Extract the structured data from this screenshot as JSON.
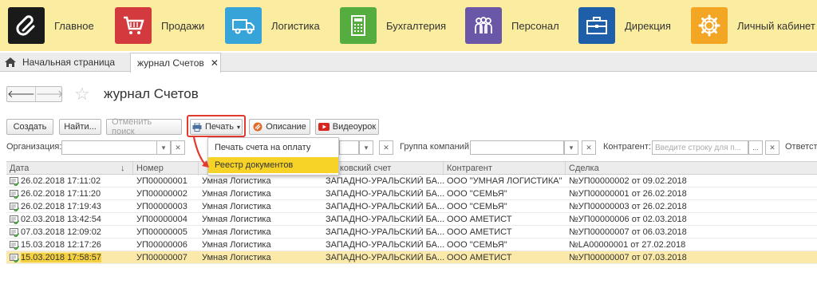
{
  "sections": [
    {
      "label": "Главное",
      "color": "#1a1a1a",
      "icon": "paperclip-icon"
    },
    {
      "label": "Продажи",
      "color": "#d23a3e",
      "icon": "cart-icon"
    },
    {
      "label": "Логистика",
      "color": "#36a3d9",
      "icon": "truck-icon"
    },
    {
      "label": "Бухгалтерия",
      "color": "#56ad3f",
      "icon": "calculator-icon"
    },
    {
      "label": "Персонал",
      "color": "#6b57a8",
      "icon": "people-icon"
    },
    {
      "label": "Дирекция",
      "color": "#1f5ea8",
      "icon": "briefcase-icon"
    },
    {
      "label": "Личный кабинет",
      "color": "#f2a624",
      "icon": "gear-icon"
    }
  ],
  "tabs": {
    "home_label": "Начальная страница",
    "active_label": "журнал Счетов",
    "close_glyph": "✕"
  },
  "header": {
    "back_glyph": "🡐",
    "forward_glyph": "🡒",
    "star_glyph": "☆",
    "title": "журнал Счетов"
  },
  "toolbar": {
    "create": "Создать",
    "find": "Найти...",
    "cancel_search": "Отменить поиск",
    "print": "Печать",
    "description": "Описание",
    "video": "Видеоурок"
  },
  "filters": {
    "org_label": "Организация:",
    "group_label": "Группа компаний:",
    "contractor_label": "Контрагент:",
    "contractor_placeholder": "Введите строку для п...",
    "responsible_label": "Ответств",
    "dropdown_glyph": "▾",
    "clear_glyph": "✕",
    "more_glyph": "..."
  },
  "print_menu": {
    "items": [
      "Печать счета на оплату",
      "Реестр документов"
    ],
    "highlighted_index": 1
  },
  "table": {
    "columns": [
      "Дата",
      "Номер",
      "",
      "ковский счет",
      "Контрагент",
      "Сделка"
    ],
    "sort_glyph": "↓",
    "rows": [
      {
        "date": "26.02.2018 17:11:02",
        "number": "УП00000001",
        "org": "Умная Логистика",
        "bank": "ЗАПАДНО-УРАЛЬСКИЙ БА...",
        "contractor": "ООО \"УМНАЯ ЛОГИСТИКА\"",
        "deal": "№УП00000002 от 09.02.2018"
      },
      {
        "date": "26.02.2018 17:11:20",
        "number": "УП00000002",
        "org": "Умная Логистика",
        "bank": "ЗАПАДНО-УРАЛЬСКИЙ БА...",
        "contractor": "ООО \"СЕМЬЯ\"",
        "deal": "№УП00000001 от 26.02.2018"
      },
      {
        "date": "26.02.2018 17:19:43",
        "number": "УП00000003",
        "org": "Умная Логистика",
        "bank": "ЗАПАДНО-УРАЛЬСКИЙ БА...",
        "contractor": "ООО \"СЕМЬЯ\"",
        "deal": "№УП00000003 от 26.02.2018"
      },
      {
        "date": "02.03.2018 13:42:54",
        "number": "УП00000004",
        "org": "Умная Логистика",
        "bank": "ЗАПАДНО-УРАЛЬСКИЙ БА...",
        "contractor": "ООО АМЕТИСТ",
        "deal": "№УП00000006 от 02.03.2018"
      },
      {
        "date": "07.03.2018 12:09:02",
        "number": "УП00000005",
        "org": "Умная Логистика",
        "bank": "ЗАПАДНО-УРАЛЬСКИЙ БА...",
        "contractor": "ООО АМЕТИСТ",
        "deal": "№УП00000007 от 06.03.2018"
      },
      {
        "date": "15.03.2018 12:17:26",
        "number": "УП00000006",
        "org": "Умная Логистика",
        "bank": "ЗАПАДНО-УРАЛЬСКИЙ БА...",
        "contractor": "ООО \"СЕМЬЯ\"",
        "deal": "№LA00000001 от 27.02.2018"
      },
      {
        "date": "15.03.2018 17:58:57",
        "number": "УП00000007",
        "org": "Умная Логистика",
        "bank": "ЗАПАДНО-УРАЛЬСКИЙ БА...",
        "contractor": "ООО АМЕТИСТ",
        "deal": "№УП00000007 от 07.03.2018"
      }
    ],
    "selected_row_index": 6
  },
  "colors": {
    "topbar": "#fbeda0",
    "highlight_box": "#e23a2f",
    "menu_highlight": "#f7d327",
    "selected_row": "#fae9a8"
  }
}
